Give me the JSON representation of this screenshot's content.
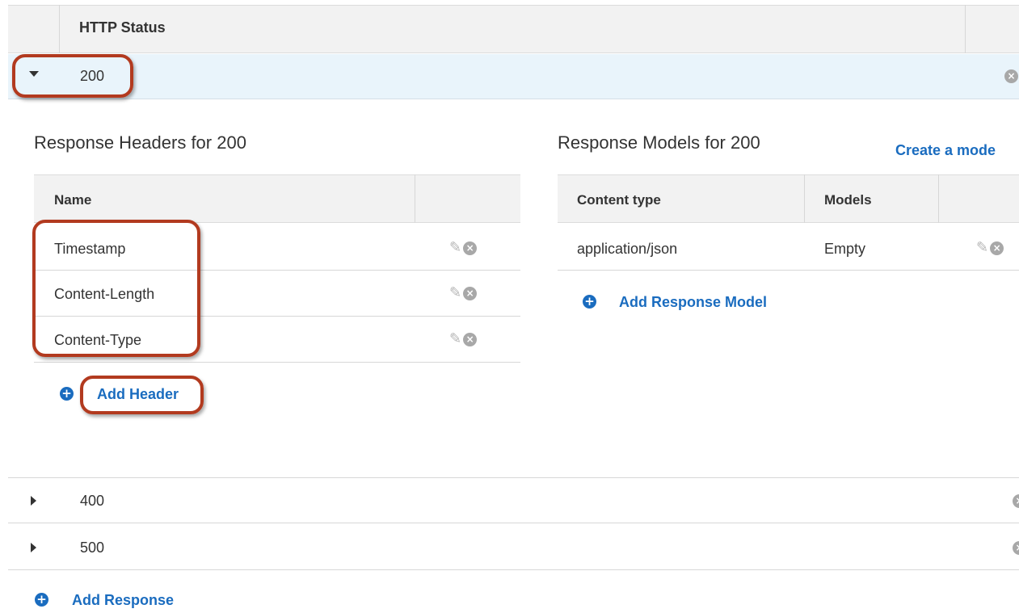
{
  "status_table": {
    "header": "HTTP Status"
  },
  "responses": [
    {
      "code": "200",
      "expanded": true
    },
    {
      "code": "400",
      "expanded": false
    },
    {
      "code": "500",
      "expanded": false
    }
  ],
  "headers_section": {
    "title": "Response Headers for 200",
    "column_name": "Name",
    "rows": [
      "Timestamp",
      "Content-Length",
      "Content-Type"
    ],
    "add_label": "Add Header"
  },
  "models_section": {
    "title": "Response Models for 200",
    "create_link": "Create a mode",
    "columns": [
      "Content type",
      "Models"
    ],
    "rows": [
      {
        "content_type": "application/json",
        "model": "Empty"
      }
    ],
    "add_label": "Add Response Model"
  },
  "add_response_label": "Add Response",
  "icons": {
    "remove": "x-circle-icon",
    "edit": "pencil-icon",
    "add": "plus-circle-icon",
    "expanded": "caret-down-icon",
    "collapsed": "caret-right-icon"
  },
  "colors": {
    "link": "#1a6cbf",
    "selected_row": "#e9f4fb",
    "header_bg": "#f2f2f2",
    "callout": "#b23a1f"
  }
}
